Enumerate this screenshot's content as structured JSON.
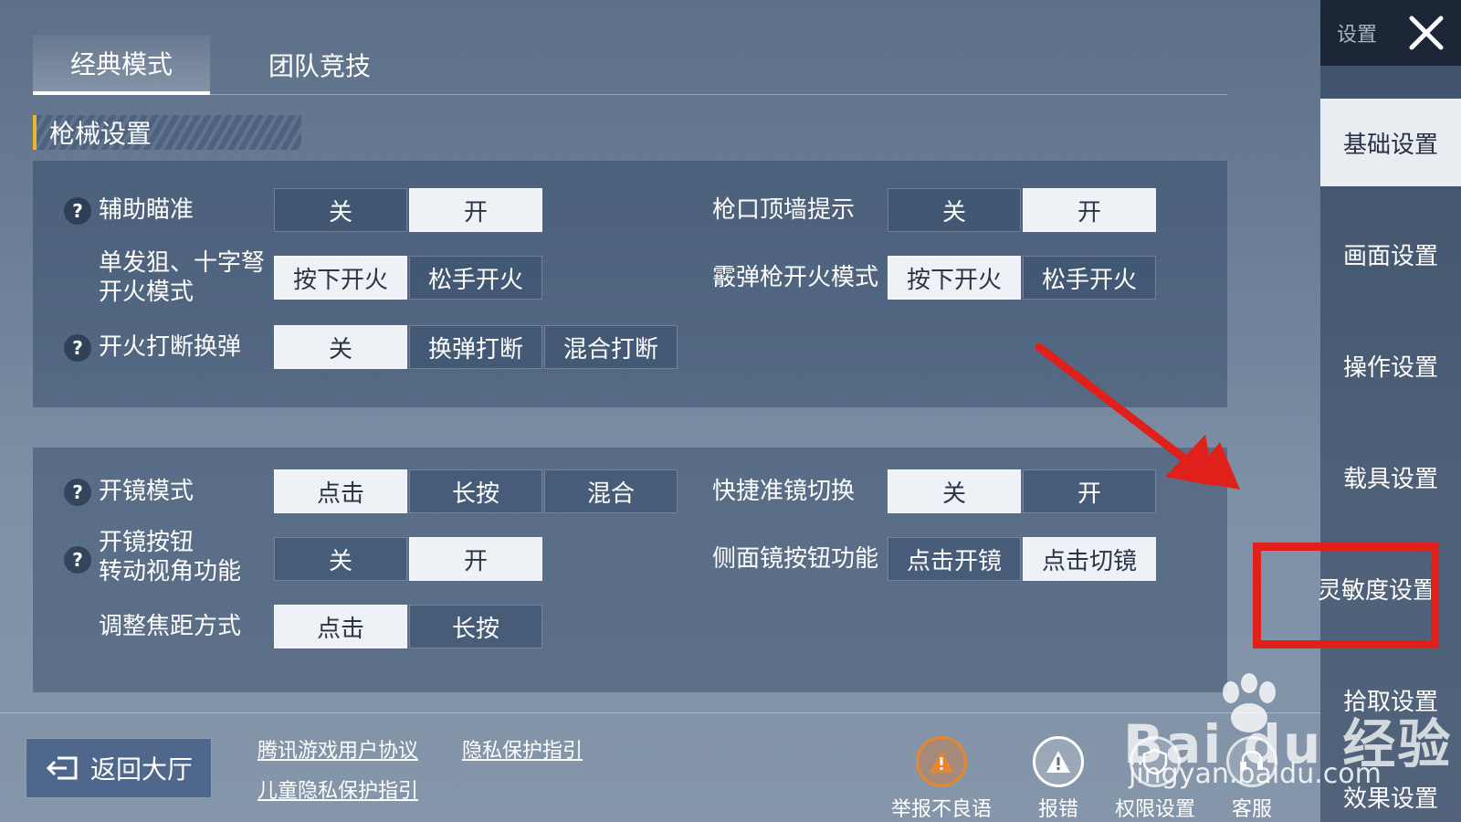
{
  "tabs": [
    {
      "label": "经典模式",
      "active": true
    },
    {
      "label": "团队竞技",
      "active": false
    }
  ],
  "section_title": "枪械设置",
  "panel1": {
    "aim_assist": {
      "label": "辅助瞄准",
      "options": [
        "关",
        "开"
      ],
      "selected": 1
    },
    "muzzle_wall": {
      "label": "枪口顶墙提示",
      "options": [
        "关",
        "开"
      ],
      "selected": 1
    },
    "single_fire": {
      "label_line1": "单发狙、十字弩",
      "label_line2": "开火模式",
      "options": [
        "按下开火",
        "松手开火"
      ],
      "selected": 0
    },
    "shotgun_fire": {
      "label": "霰弹枪开火模式",
      "options": [
        "按下开火",
        "松手开火"
      ],
      "selected": 0
    },
    "fire_interrupt": {
      "label": "开火打断换弹",
      "options": [
        "关",
        "换弹打断",
        "混合打断"
      ],
      "selected": 0
    }
  },
  "panel2": {
    "scope_mode": {
      "label": "开镜模式",
      "options": [
        "点击",
        "长按",
        "混合"
      ],
      "selected": 0
    },
    "quick_scope": {
      "label": "快捷准镜切换",
      "options": [
        "关",
        "开"
      ],
      "selected": 0
    },
    "scope_rotate": {
      "label_line1": "开镜按钮",
      "label_line2": "转动视角功能",
      "options": [
        "关",
        "开"
      ],
      "selected": 1
    },
    "side_scope": {
      "label": "侧面镜按钮功能",
      "options": [
        "点击开镜",
        "点击切镜"
      ],
      "selected": 1
    },
    "focus_mode": {
      "label": "调整焦距方式",
      "options": [
        "点击",
        "长按"
      ],
      "selected": 0
    }
  },
  "help_icon": "?",
  "footer": {
    "back_label": "返回大厅",
    "links": [
      "腾讯游戏用户协议",
      "隐私保护指引",
      "儿童隐私保护指引"
    ],
    "actions": [
      {
        "label": "举报不良语音",
        "icon": "warning-voice-icon"
      },
      {
        "label": "报错",
        "icon": "warning-icon"
      },
      {
        "label": "权限设置",
        "icon": "permission-icon"
      },
      {
        "label": "客服",
        "icon": "support-icon"
      }
    ]
  },
  "sidebar": {
    "header_label": "设置",
    "items": [
      "基础设置",
      "画面设置",
      "操作设置",
      "载具设置",
      "灵敏度设置",
      "拾取设置",
      "效果设置"
    ],
    "active_index": 0
  },
  "watermark": {
    "brand": "Bai du 经验",
    "url": "jingyan.baidu.com"
  },
  "colors": {
    "accent_red": "#e0201b",
    "section_marker": "#f0b429",
    "selected_option": "#eef1f5"
  }
}
